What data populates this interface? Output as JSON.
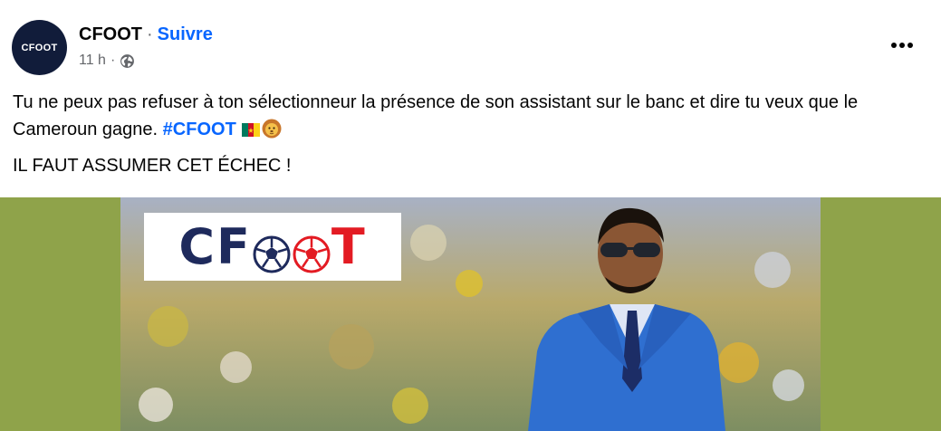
{
  "post": {
    "page_name": "CFOOT",
    "separator": "·",
    "follow_label": "Suivre",
    "time": "11 h",
    "meta_separator": "·",
    "avatar_text": "CFOOT",
    "paragraph1_text": "Tu ne peux pas refuser à ton sélectionneur la présence de son assistant sur le banc et dire tu veux que le Cameroun gagne. ",
    "hashtag": "#CFOOT",
    "paragraph2_text": "IL FAUT ASSUMER CET ÉCHEC !"
  },
  "media": {
    "logo_c": "CF",
    "logo_end_o": "",
    "logo_t": "T"
  },
  "icons": [
    "globe-icon",
    "more-options-icon",
    "cameroon-flag-emoji",
    "lion-emoji",
    "soccer-ball-icon"
  ],
  "colors": {
    "link_blue": "#0866ff",
    "secondary_text": "#65676b",
    "media_background": "#8fa34a",
    "logo_navy": "#1e2a5c",
    "logo_red": "#e31b23"
  }
}
